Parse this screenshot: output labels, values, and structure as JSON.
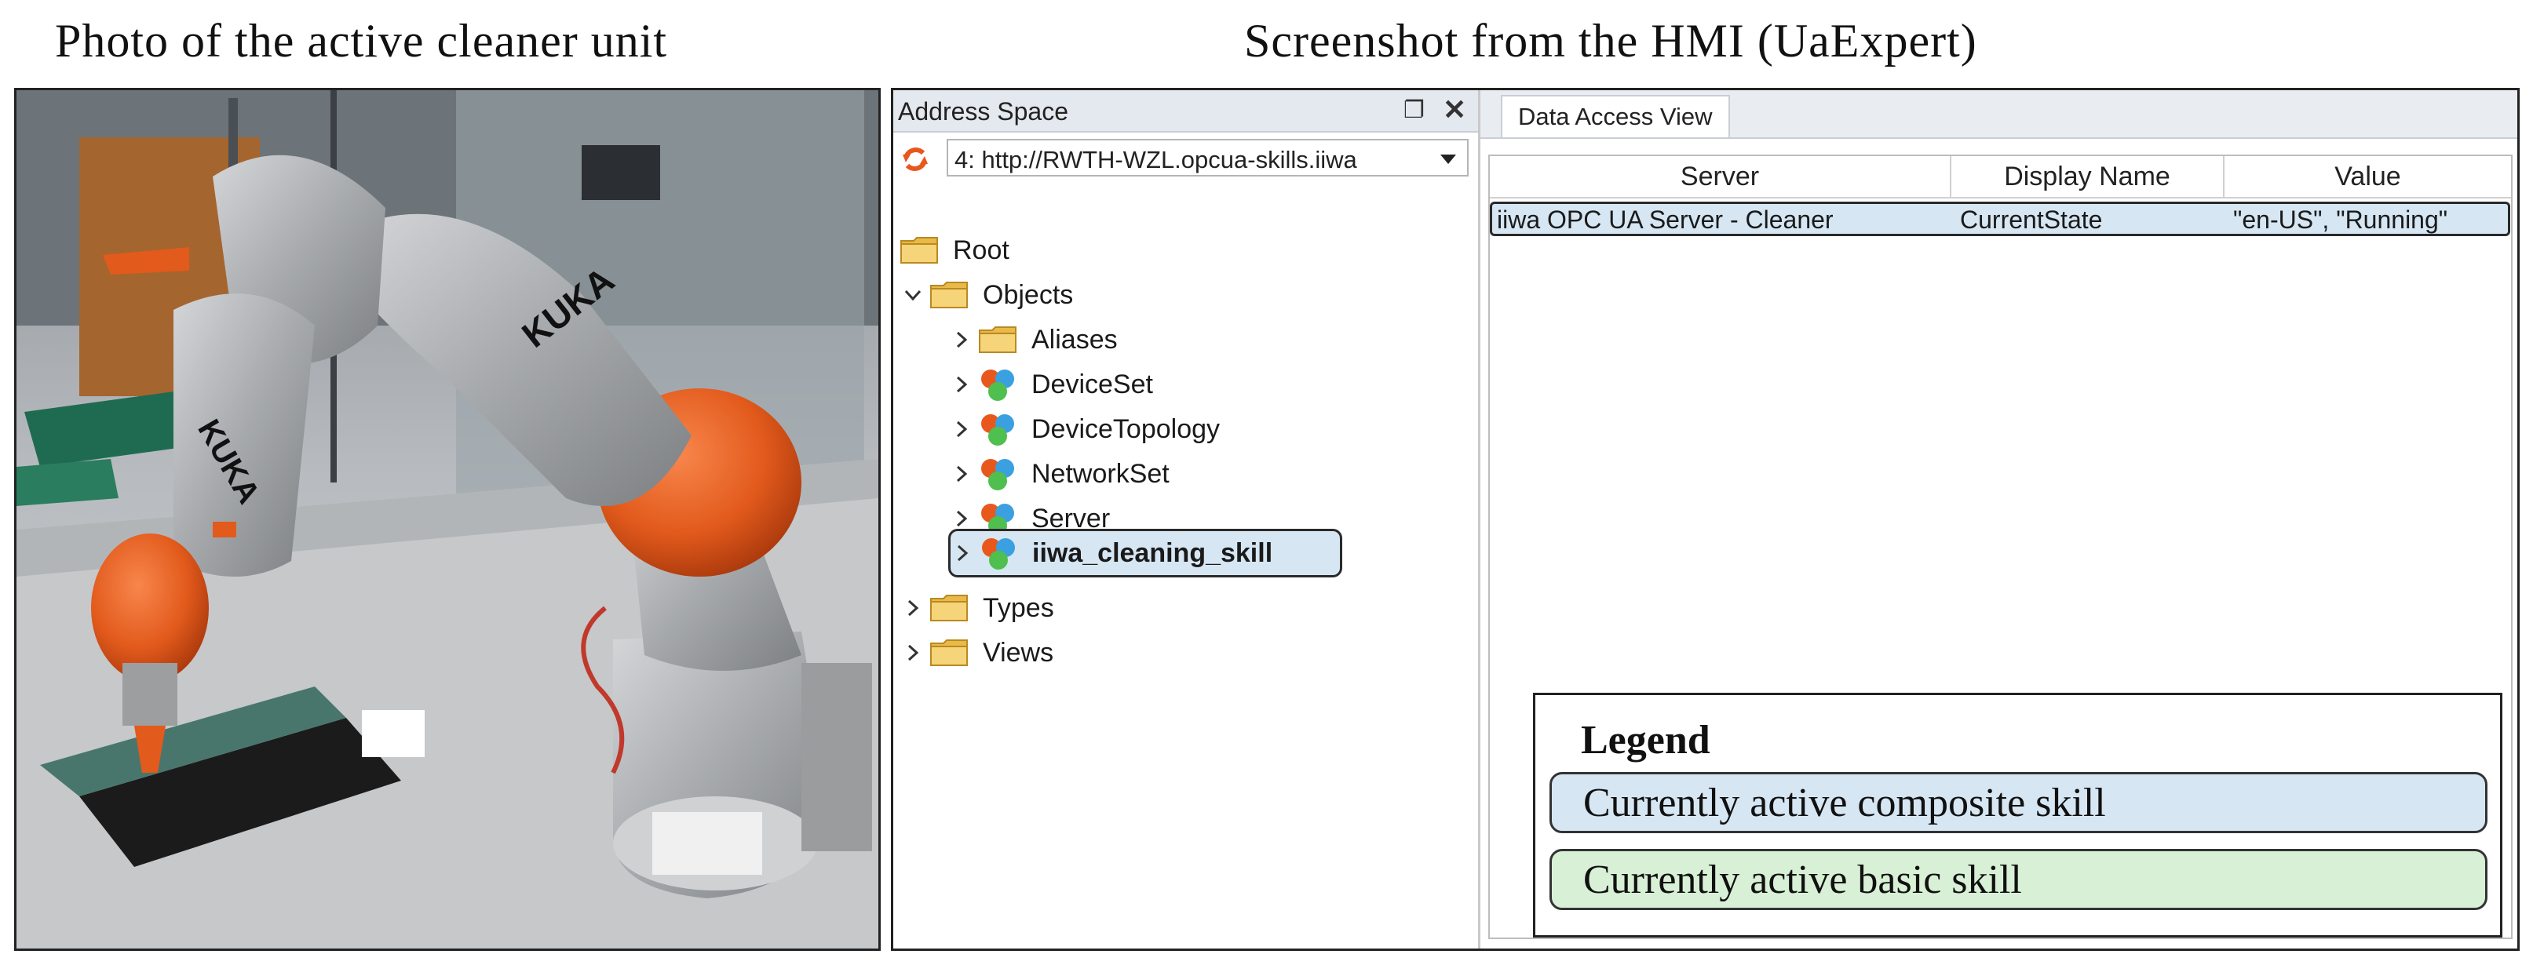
{
  "captions": {
    "left": "Photo of the active cleaner unit",
    "right": "Screenshot from the HMI (UaExpert)"
  },
  "address_space": {
    "title": "Address Space",
    "float_icon": "float-window-icon",
    "close_icon": "close-icon",
    "server": "4: http://RWTH-WZL.opcua-skills.iiwa",
    "tree": [
      {
        "label": "Root",
        "icon": "folder-icon",
        "expanded": null
      },
      {
        "label": "Objects",
        "icon": "folder-icon",
        "expanded": true
      },
      {
        "label": "Aliases",
        "icon": "folder-icon",
        "expanded": false
      },
      {
        "label": "DeviceSet",
        "icon": "object-node-icon",
        "expanded": false
      },
      {
        "label": "DeviceTopology",
        "icon": "object-node-icon",
        "expanded": false
      },
      {
        "label": "NetworkSet",
        "icon": "object-node-icon",
        "expanded": false
      },
      {
        "label": "Server",
        "icon": "object-node-icon",
        "expanded": false
      },
      {
        "label": "iiwa_cleaning_skill",
        "icon": "object-node-icon",
        "expanded": false,
        "selected": true
      },
      {
        "label": "Types",
        "icon": "folder-icon",
        "expanded": false
      },
      {
        "label": "Views",
        "icon": "folder-icon",
        "expanded": false
      }
    ]
  },
  "data_access_view": {
    "tab": "Data Access View",
    "columns": [
      "Server",
      "Display Name",
      "Value"
    ],
    "rows": [
      {
        "server": "iiwa OPC UA Server - Cleaner",
        "display_name": "CurrentState",
        "value": "\"en-US\", \"Running\""
      }
    ]
  },
  "legend": {
    "title": "Legend",
    "items": [
      {
        "label": "Currently active composite skill",
        "color": "#d6e6f3"
      },
      {
        "label": "Currently active basic skill",
        "color": "#d8f0d6"
      }
    ]
  },
  "colors": {
    "selection": "#d6e6f3",
    "robot_orange": "#e8581c",
    "robot_gray": "#a9abad"
  }
}
